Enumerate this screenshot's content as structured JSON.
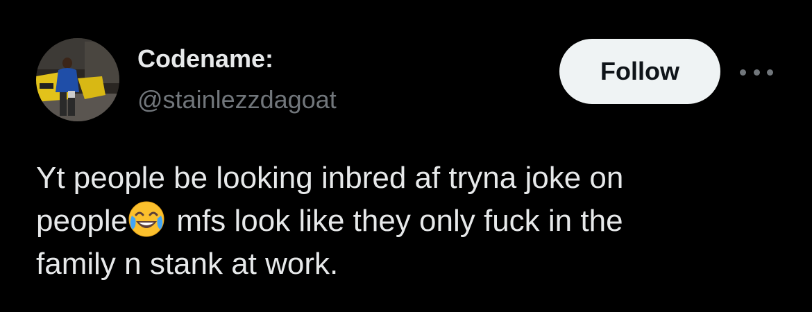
{
  "user": {
    "display_name": "Codename:",
    "handle": "@stainlezzdagoat",
    "avatar_icon": "avatar-photo"
  },
  "actions": {
    "follow_label": "Follow",
    "more_icon": "more-horizontal-icon"
  },
  "tweet": {
    "line1": "Yt people be looking inbred af tryna joke on",
    "line2_before_emoji": "people",
    "emoji_icon": "face-with-tears-of-joy-icon",
    "line2_after_emoji": " mfs look like they only fuck in the",
    "line3": "family n stank at work."
  },
  "colors": {
    "background": "#000000",
    "primary_text": "#e7e9ea",
    "secondary_text": "#71767b",
    "follow_button_bg": "#eff3f4",
    "follow_button_text": "#0f1419"
  }
}
